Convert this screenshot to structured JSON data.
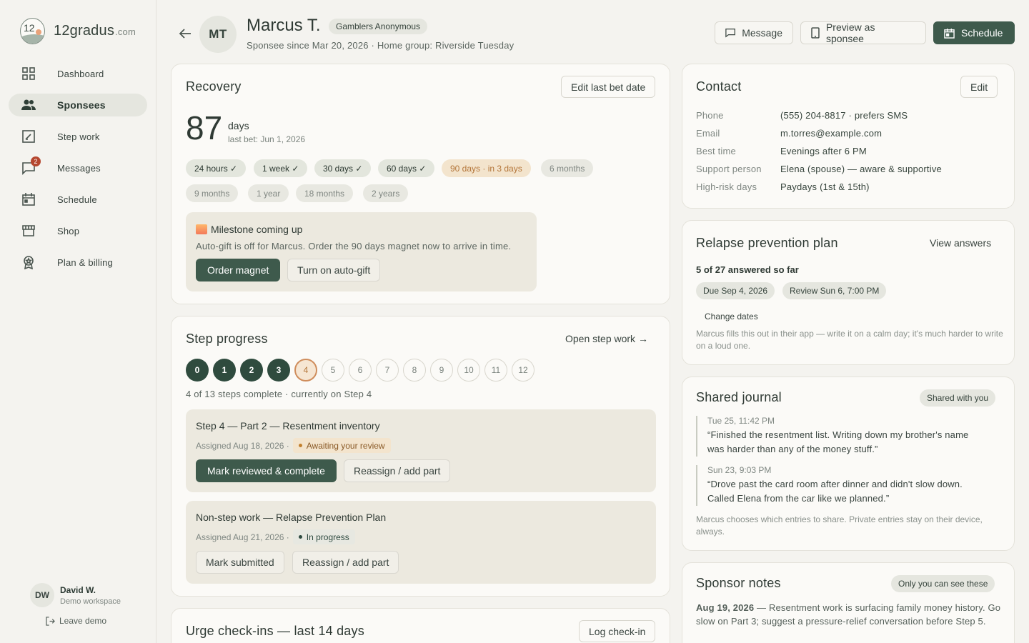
{
  "brand": {
    "name": "12gradus",
    "domain": ".com",
    "logo_text": "12"
  },
  "nav": [
    {
      "key": "dashboard",
      "label": "Dashboard",
      "icon": "grid-icon"
    },
    {
      "key": "sponsees",
      "label": "Sponsees",
      "icon": "people-icon",
      "active": true
    },
    {
      "key": "step-work",
      "label": "Step work",
      "icon": "edit-square-icon"
    },
    {
      "key": "messages",
      "label": "Messages",
      "icon": "chat-icon",
      "badge": "2"
    },
    {
      "key": "schedule",
      "label": "Schedule",
      "icon": "calendar-icon"
    },
    {
      "key": "shop",
      "label": "Shop",
      "icon": "storefront-icon"
    },
    {
      "key": "plan-billing",
      "label": "Plan & billing",
      "icon": "award-icon"
    }
  ],
  "user": {
    "initials": "DW",
    "name": "David W.",
    "workspace": "Demo workspace",
    "leave": "Leave demo"
  },
  "header": {
    "initials": "MT",
    "name": "Marcus T.",
    "group": "Gamblers Anonymous",
    "subline": "Sponsee since Mar 20, 2026 · Home group: Riverside Tuesday",
    "message_btn": "Message",
    "preview_btn": "Preview as sponsee",
    "schedule_btn": "Schedule"
  },
  "recovery": {
    "title": "Recovery",
    "edit_btn": "Edit last bet date",
    "days": "87",
    "days_word": "days",
    "last_bet": "last bet: Jun 1, 2026",
    "milestones": [
      {
        "label": "24 hours ✓",
        "state": "done"
      },
      {
        "label": "1 week ✓",
        "state": "done"
      },
      {
        "label": "30 days ✓",
        "state": "done"
      },
      {
        "label": "60 days ✓",
        "state": "done"
      },
      {
        "label": "90 days · in 3 days",
        "state": "next"
      },
      {
        "label": "6 months",
        "state": "future"
      },
      {
        "label": "9 months",
        "state": "future"
      },
      {
        "label": "1 year",
        "state": "future"
      },
      {
        "label": "18 months",
        "state": "future"
      },
      {
        "label": "2 years",
        "state": "future"
      }
    ],
    "callout": {
      "title": "Milestone coming up",
      "body": "Auto-gift is off for Marcus. Order the 90 days magnet now to arrive in time.",
      "order_btn": "Order magnet",
      "autogift_btn": "Turn on auto-gift"
    }
  },
  "steps": {
    "title": "Step progress",
    "open_link": "Open step work →",
    "items": [
      "0",
      "1",
      "2",
      "3",
      "4",
      "5",
      "6",
      "7",
      "8",
      "9",
      "10",
      "11",
      "12"
    ],
    "completed": 4,
    "current": 4,
    "summary": "4 of 13 steps complete · currently on Step 4",
    "tasks": [
      {
        "title": "Step 4 — Part 2 — Resentment inventory",
        "assigned": "Assigned Aug 18, 2026 ·",
        "status": "Awaiting your review",
        "primary": "Mark reviewed & complete",
        "secondary": "Reassign / add part"
      },
      {
        "title": "Non-step work — Relapse Prevention Plan",
        "assigned": "Assigned Aug 21, 2026 ·",
        "status": "In progress",
        "primary": "Mark submitted",
        "secondary": "Reassign / add part"
      }
    ]
  },
  "urges": {
    "title": "Urge check-ins — last 14 days",
    "log_btn": "Log check-in"
  },
  "contact": {
    "title": "Contact",
    "edit_btn": "Edit",
    "rows": [
      {
        "key": "Phone",
        "value": "(555) 204-8817 · prefers SMS"
      },
      {
        "key": "Email",
        "value": "m.torres@example.com"
      },
      {
        "key": "Best time",
        "value": "Evenings after 6 PM"
      },
      {
        "key": "Support person",
        "value": "Elena (spouse) — aware & supportive"
      },
      {
        "key": "High-risk days",
        "value": "Paydays (1st & 15th)"
      }
    ]
  },
  "relapse": {
    "title": "Relapse prevention plan",
    "view_link": "View answers",
    "answered": "5 of 27 answered so far",
    "due": "Due Sep 4, 2026",
    "review": "Review Sun 6, 7:00 PM",
    "change_dates": "Change dates",
    "note": "Marcus fills this out in their app — write it on a calm day; it's much harder to write on a loud one."
  },
  "journal": {
    "title": "Shared journal",
    "chip": "Shared with you",
    "entries": [
      {
        "time": "Tue 25, 11:42 PM",
        "text": "“Finished the resentment list. Writing down my brother's name was harder than any of the money stuff.”"
      },
      {
        "time": "Sun 23, 9:03 PM",
        "text": "“Drove past the card room after dinner and didn't slow down. Called Elena from the car like we planned.”"
      }
    ],
    "note": "Marcus chooses which entries to share. Private entries stay on their device, always."
  },
  "notes": {
    "title": "Sponsor notes",
    "chip": "Only you can see these",
    "date": "Aug 19, 2026",
    "text": " — Resentment work is surfacing family money history. Go slow on Part 3; suggest a pressure-relief conversation before Step 5."
  },
  "colors": {
    "primary": "#3e5a4c",
    "accent": "#cf8d5c",
    "background": "#f4f3ef",
    "card": "#fbfaf7",
    "badge": "#b5472f"
  }
}
